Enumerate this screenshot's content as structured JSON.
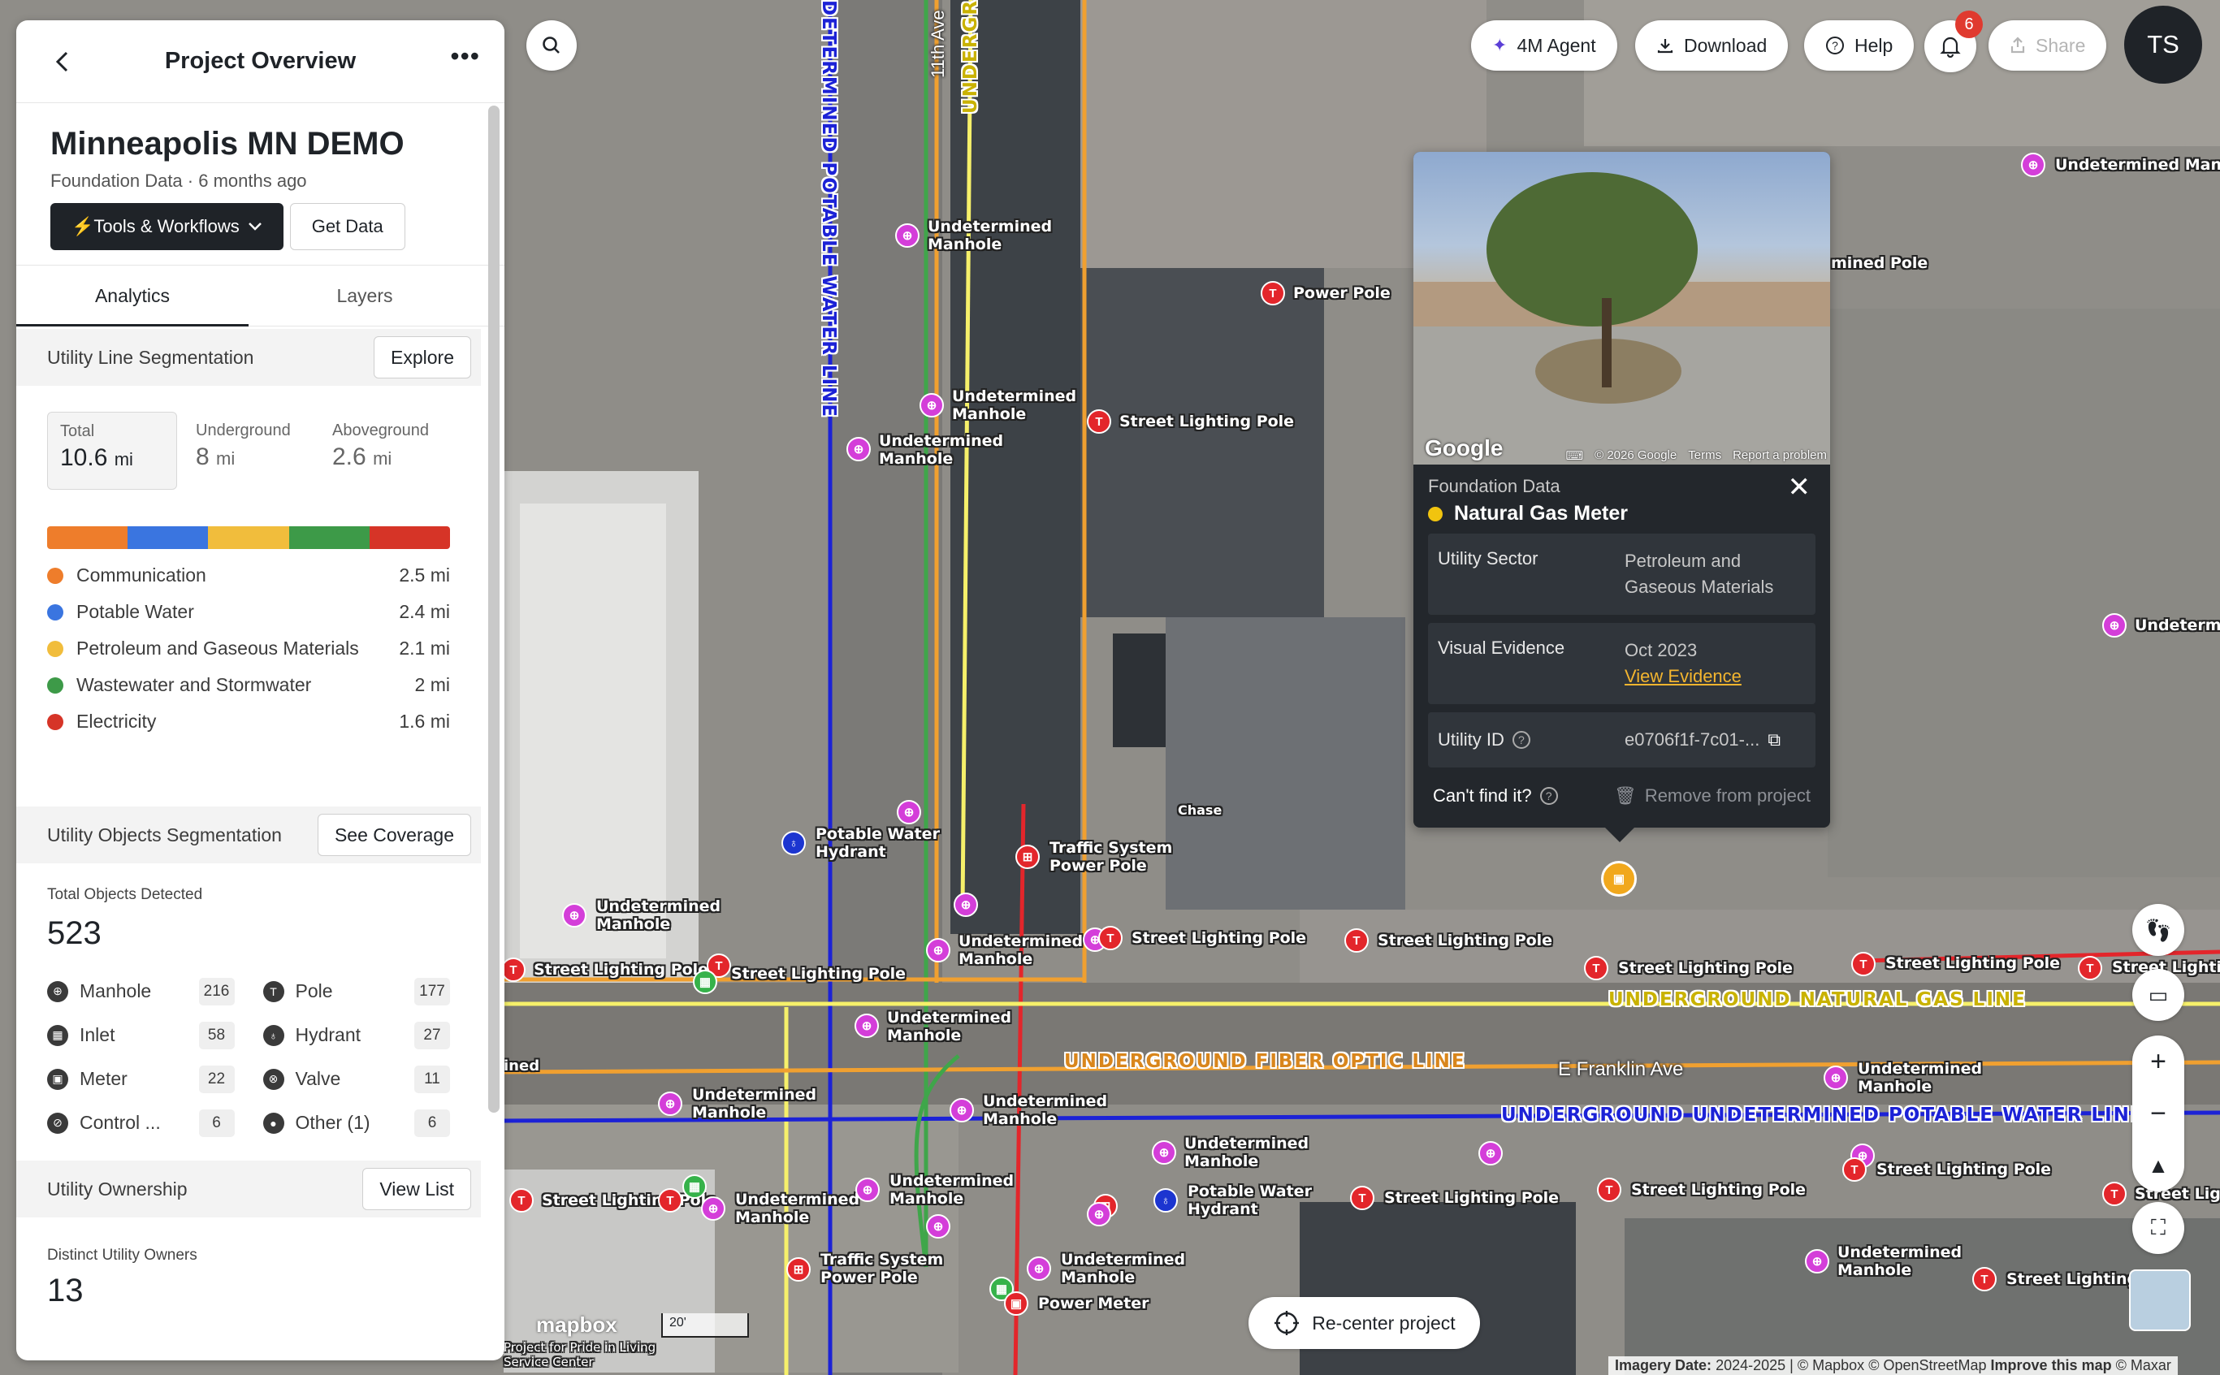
{
  "panel": {
    "header_title": "Project Overview",
    "project_name": "Minneapolis MN DEMO",
    "project_source": "Foundation Data",
    "project_age": "6 months ago",
    "tools_label": "⚡Tools & Workflows",
    "get_data_label": "Get Data",
    "tabs": [
      {
        "label": "Analytics",
        "active": true
      },
      {
        "label": "Layers",
        "active": false
      }
    ]
  },
  "line_segmentation": {
    "title": "Utility Line Segmentation",
    "button": "Explore",
    "stats": [
      {
        "label": "Total",
        "value": "10.6",
        "unit": "mi"
      },
      {
        "label": "Underground",
        "value": "8",
        "unit": "mi"
      },
      {
        "label": "Aboveground",
        "value": "2.6",
        "unit": "mi"
      }
    ],
    "legend": [
      {
        "name": "Communication",
        "value": "2.5 mi",
        "color": "#ee7d2b"
      },
      {
        "name": "Potable Water",
        "value": "2.4 mi",
        "color": "#3a75e0"
      },
      {
        "name": "Petroleum and Gaseous Materials",
        "value": "2.1 mi",
        "color": "#f1bd3c"
      },
      {
        "name": "Wastewater and Stormwater",
        "value": "2 mi",
        "color": "#3d9a48"
      },
      {
        "name": "Electricity",
        "value": "1.6 mi",
        "color": "#d63427"
      }
    ]
  },
  "objects_segmentation": {
    "title": "Utility Objects Segmentation",
    "button": "See Coverage",
    "total_label": "Total Objects Detected",
    "total_value": "523",
    "items": [
      {
        "name": "Manhole",
        "count": "216",
        "icon": "manhole-icon"
      },
      {
        "name": "Pole",
        "count": "177",
        "icon": "pole-icon"
      },
      {
        "name": "Inlet",
        "count": "58",
        "icon": "inlet-icon"
      },
      {
        "name": "Hydrant",
        "count": "27",
        "icon": "hydrant-icon"
      },
      {
        "name": "Meter",
        "count": "22",
        "icon": "meter-icon"
      },
      {
        "name": "Valve",
        "count": "11",
        "icon": "valve-icon"
      },
      {
        "name": "Control ...",
        "count": "6",
        "icon": "control-icon"
      },
      {
        "name": "Other (1)",
        "count": "6",
        "icon": "other-icon"
      }
    ]
  },
  "ownership": {
    "title": "Utility Ownership",
    "button": "View List",
    "owners_label": "Distinct Utility Owners",
    "owners_value": "13"
  },
  "topbar": {
    "agent_label": "4M Agent",
    "download_label": "Download",
    "help_label": "Help",
    "notifications_count": "6",
    "share_label": "Share",
    "avatar_initials": "TS"
  },
  "popup": {
    "source": "Foundation Data",
    "title": "Natural Gas Meter",
    "photo_attribution": [
      "© 2026 Google",
      "Terms",
      "Report a problem"
    ],
    "photo_brand": "Google",
    "rows": {
      "sector_key": "Utility Sector",
      "sector_value_1": "Petroleum and",
      "sector_value_2": "Gaseous Materials",
      "evidence_key": "Visual Evidence",
      "evidence_date": "Oct 2023",
      "evidence_link": "View Evidence",
      "id_key": "Utility ID",
      "id_value": "e0706f1f-7c01-..."
    },
    "cant_find": "Can't find it?",
    "remove_label": "Remove from project"
  },
  "map": {
    "line_labels": [
      "UNDERGROUND NATURAL GAS LINE",
      "UNDERGROUND FIBER OPTIC LINE",
      "UNDERGROUND UNDETERMINED POTABLE WATER LINE",
      "DETERMINED POTABLE WATER LINE",
      "UNDERGR"
    ],
    "streets": [
      "E Franklin Ave",
      "11th Ave"
    ],
    "labels": {
      "und_manhole_1": "Undetermined Manhole",
      "power_pole": "Power Pole",
      "street_lighting_pole": "Street Lighting Pole",
      "potable_water_hydrant": "Potable Water Hydrant",
      "traffic_system_power_pole": "Traffic System Power Pole",
      "power_meter": "Power Meter",
      "chase": "Chase",
      "ined": "ined",
      "pole_partial": "mined Pole",
      "undeterm_partial": "Undeterm",
      "street_lightin_partial": "Street Lightin",
      "street_light_partial": "Street Light",
      "street_lighting_partial": "Street Lighting"
    },
    "recenter_label": "Re-center project",
    "mapbox_logo": "mapbox",
    "scale_label": "20'",
    "attribution": {
      "imagery_label": "Imagery Date:",
      "imagery_value": "2024-2025",
      "mapbox": "© Mapbox",
      "osm": "© OpenStreetMap",
      "improve": "Improve this map",
      "maxar": "© Maxar"
    },
    "place_caption": "Project for Pride in Living Service Center",
    "colors": {
      "gas": "#f6f06a",
      "fiber": "#f0a030",
      "water": "#1c22d6",
      "sewer": "#3fa64a",
      "electric": "#e3262b",
      "marker_magenta": "#d43ed9"
    }
  }
}
